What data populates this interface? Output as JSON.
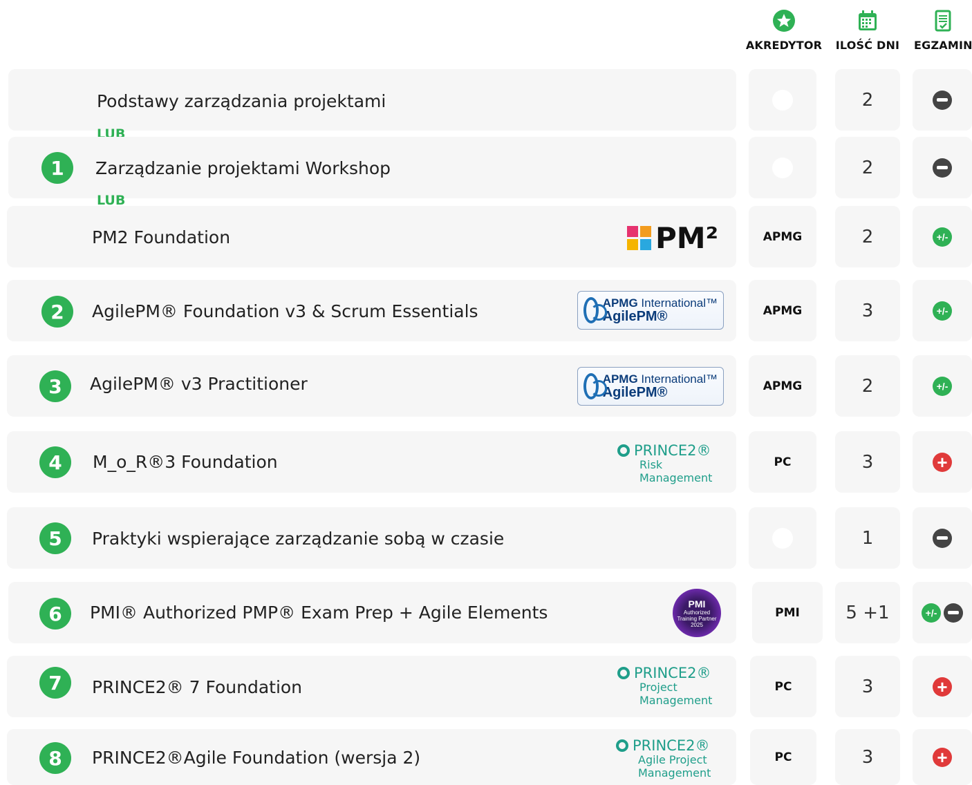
{
  "header": {
    "accreditor_label": "AKREDYTOR",
    "days_label": "ILOŚĆ DNI",
    "exam_label": "EGZAMIN"
  },
  "connector": "LUB",
  "steps": [
    "1",
    "2",
    "3",
    "4",
    "5",
    "6",
    "7",
    "8"
  ],
  "rows": [
    {
      "title": "Podstawy zarządzania projektami",
      "accreditor": "",
      "days": "2",
      "exam": [
        "minus"
      ]
    },
    {
      "title": "Zarządzanie projektami Workshop",
      "accreditor": "",
      "days": "2",
      "exam": [
        "minus"
      ]
    },
    {
      "title": "PM2 Foundation",
      "accreditor": "APMG",
      "days": "2",
      "exam": [
        "plus-minus"
      ],
      "logo": "pm2"
    },
    {
      "title": "AgilePM® Foundation v3 & Scrum Essentials",
      "accreditor": "APMG",
      "days": "3",
      "exam": [
        "plus-minus"
      ],
      "logo": "apmg-agilepm"
    },
    {
      "title": "AgilePM® v3 Practitioner",
      "accreditor": "APMG",
      "days": "2",
      "exam": [
        "plus-minus"
      ],
      "logo": "apmg-agilepm"
    },
    {
      "title": "M_o_R®3 Foundation",
      "accreditor": "PC",
      "days": "3",
      "exam": [
        "plus"
      ],
      "logo": "prince2-risk"
    },
    {
      "title": "Praktyki wspierające zarządzanie sobą w czasie",
      "accreditor": "",
      "days": "1",
      "exam": [
        "minus"
      ]
    },
    {
      "title": "PMI® Authorized PMP® Exam Prep + Agile Elements",
      "accreditor": "PMI",
      "days": "5 +1",
      "exam": [
        "plus-minus",
        "minus"
      ],
      "logo": "pmi-atp"
    },
    {
      "title": "PRINCE2® 7 Foundation",
      "accreditor": "PC",
      "days": "3",
      "exam": [
        "plus"
      ],
      "logo": "prince2-pm"
    },
    {
      "title": "PRINCE2®Agile Foundation (wersja 2)",
      "accreditor": "PC",
      "days": "3",
      "exam": [
        "plus"
      ],
      "logo": "prince2-agile"
    }
  ],
  "logos": {
    "pm2": {
      "text": "PM²"
    },
    "apmg": {
      "line1_bold": "APMG",
      "line1_rest": "International™",
      "line2": "AgilePM®"
    },
    "prince2_risk": {
      "brand": "PRINCE2®",
      "line1": "Risk",
      "line2": "Management"
    },
    "prince2_pm": {
      "brand": "PRINCE2®",
      "line1": "Project",
      "line2": "Management"
    },
    "prince2_agile": {
      "brand": "PRINCE2®",
      "line1": "Agile Project",
      "line2": "Management"
    },
    "pmi": {
      "mark": "PMI",
      "line1": "Authorized",
      "line2": "Training Partner",
      "line3": "2025"
    }
  },
  "exam_symbols": {
    "plus": "+",
    "plus_minus": "+/-"
  },
  "colors": {
    "green": "#2fb155",
    "red": "#e03a3a",
    "dark": "#444444",
    "card": "#f6f6f6",
    "teal": "#1f9e8a"
  }
}
